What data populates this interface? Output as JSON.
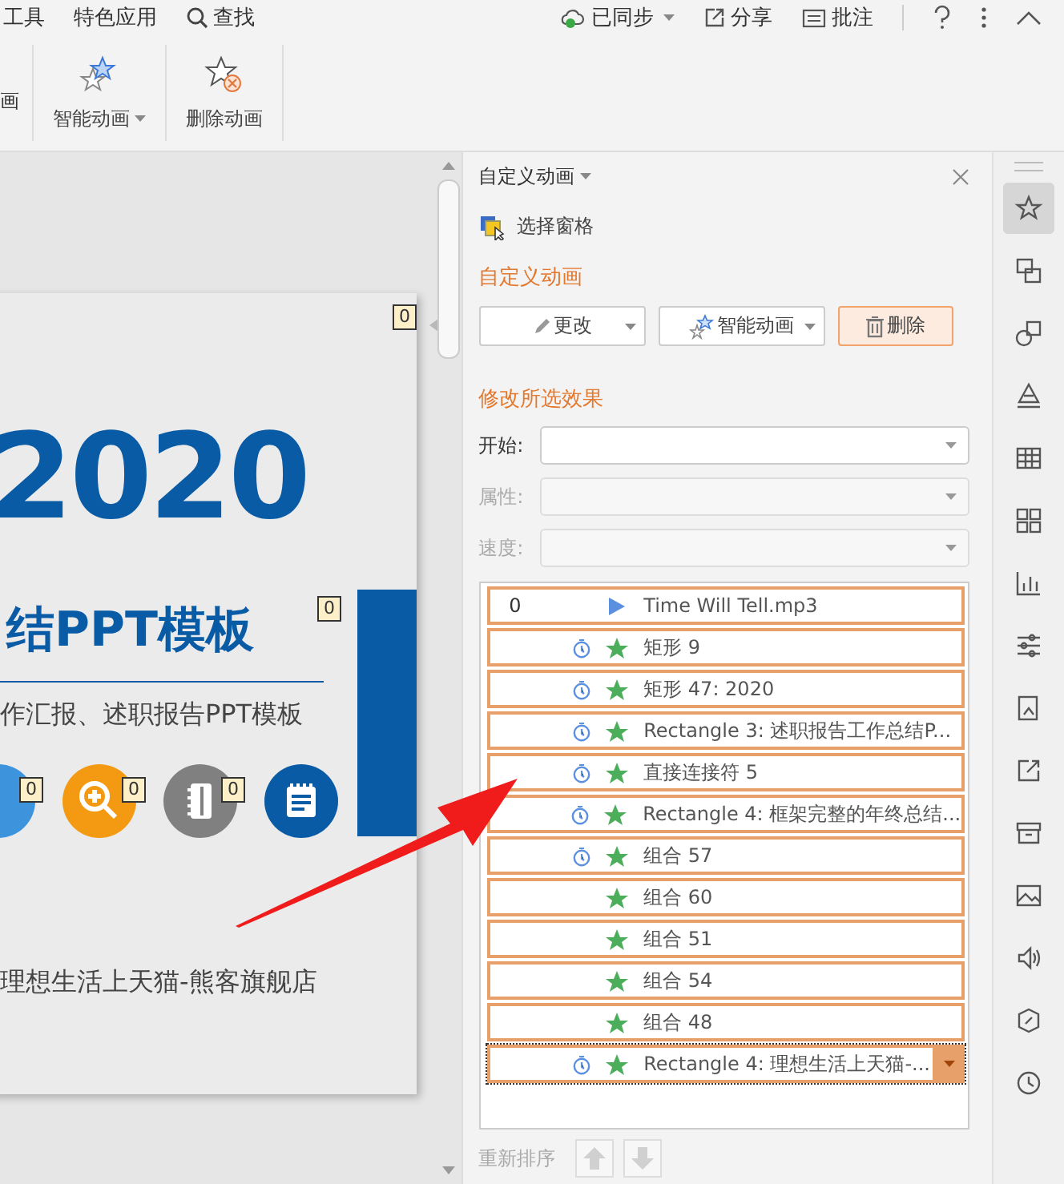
{
  "menu_bar": {
    "items": [
      {
        "label": "工具"
      },
      {
        "label": "特色应用"
      },
      {
        "label": "查找",
        "kind": "search"
      }
    ],
    "sync": "已同步",
    "share": "分享",
    "comment": "批注"
  },
  "ribbon": {
    "cut_label": "画",
    "buttons": [
      {
        "label": "智能动画",
        "kind": "smart",
        "has_menu": true
      },
      {
        "label": "删除动画",
        "kind": "delete",
        "has_menu": false
      }
    ]
  },
  "slide": {
    "year": "2020",
    "title": "结PPT模板",
    "subtitle": "作汇报、述职报告PPT模板",
    "footer": "理想生活上天猫-熊客旗舰店",
    "badges": [
      "0",
      "0",
      "0",
      "0",
      "0"
    ]
  },
  "panel": {
    "title": "自定义动画",
    "selection_pane": "选择窗格",
    "section_title": "自定义动画",
    "buttons": [
      {
        "label": "更改",
        "kind": "edit",
        "has_menu": true,
        "selected": false
      },
      {
        "label": "智能动画",
        "kind": "smart",
        "has_menu": true,
        "selected": false
      },
      {
        "label": "删除",
        "kind": "delete",
        "has_menu": false,
        "selected": true
      }
    ],
    "modify_title": "修改所选效果",
    "fields": [
      {
        "label": "开始:",
        "disabled": false
      },
      {
        "label": "属性:",
        "disabled": true
      },
      {
        "label": "速度:",
        "disabled": true
      }
    ],
    "effects": [
      {
        "order": "0",
        "kind": "media",
        "timed": false,
        "label": "Time Will Tell.mp3",
        "selected": true,
        "focused": false
      },
      {
        "kind": "effect",
        "timed": true,
        "label": "矩形 9",
        "selected": true,
        "focused": false
      },
      {
        "kind": "effect",
        "timed": true,
        "label": "矩形 47: 2020",
        "selected": true,
        "focused": false
      },
      {
        "kind": "effect",
        "timed": true,
        "label": "Rectangle 3: 述职报告工作总结P...",
        "selected": true,
        "focused": false
      },
      {
        "kind": "effect",
        "timed": true,
        "label": "直接连接符 5",
        "selected": true,
        "focused": false
      },
      {
        "kind": "effect",
        "timed": true,
        "label": "Rectangle 4: 框架完整的年终总结...",
        "selected": true,
        "focused": false
      },
      {
        "kind": "effect",
        "timed": true,
        "label": "组合 57",
        "selected": true,
        "focused": false
      },
      {
        "kind": "effect",
        "timed": false,
        "label": "组合 60",
        "selected": true,
        "focused": false
      },
      {
        "kind": "effect",
        "timed": false,
        "label": "组合 51",
        "selected": true,
        "focused": false
      },
      {
        "kind": "effect",
        "timed": false,
        "label": "组合 54",
        "selected": true,
        "focused": false
      },
      {
        "kind": "effect",
        "timed": false,
        "label": "组合 48",
        "selected": true,
        "focused": false
      },
      {
        "kind": "effect",
        "timed": true,
        "label": "Rectangle 4: 理想生活上天猫-...",
        "selected": true,
        "focused": true
      }
    ],
    "reorder": {
      "label": "重新排序",
      "disabled": true
    }
  },
  "sidebar_tools": [
    {
      "selected": true
    },
    {
      "selected": false
    },
    {
      "selected": false
    },
    {
      "selected": false
    },
    {
      "selected": false
    },
    {
      "selected": false
    },
    {
      "selected": false
    },
    {
      "selected": false
    },
    {
      "selected": false
    },
    {
      "selected": false
    },
    {
      "selected": false
    },
    {
      "selected": false
    },
    {
      "selected": false
    },
    {
      "selected": false
    },
    {
      "selected": false
    }
  ]
}
